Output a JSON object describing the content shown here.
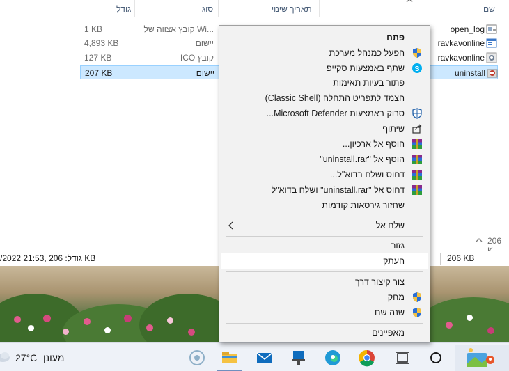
{
  "explorer": {
    "columns": {
      "name": "שם",
      "modified": "תאריך שינוי",
      "type": "סוג",
      "size": "גודל"
    },
    "files": [
      {
        "name": "open_log",
        "type": "...Wi קובץ אצווה של",
        "size": "1 KB",
        "icon": "batch-file-icon"
      },
      {
        "name": "ravkavonline",
        "type": "יישום",
        "size": "4,893 KB",
        "icon": "app-window-icon"
      },
      {
        "name": "ravkavonline",
        "type": "קובץ ICO",
        "size": "127 KB",
        "icon": "ico-file-icon"
      },
      {
        "name": "uninstall",
        "type": "יישום",
        "size": "207 KB",
        "icon": "uninstall-app-icon",
        "selected": true
      }
    ],
    "right_size": "206 K",
    "status_left": "/2022 21:53,  גודל: 206 KB",
    "status_right": "206 KB"
  },
  "context_menu": {
    "items": [
      {
        "label": "פתח",
        "bold": true
      },
      {
        "label": "הפעל כמנהל מערכת",
        "icon": "uac-shield-icon"
      },
      {
        "label": "שתף באמצעות סקייפ",
        "icon": "skype-icon"
      },
      {
        "label": "פתור בעיות תאימות"
      },
      {
        "label": "הצמד לתפריט התחלה (Classic Shell)"
      },
      {
        "label": "סרוק באמצעות Microsoft Defender...",
        "icon": "defender-icon"
      },
      {
        "label": "שיתוף",
        "icon": "share-icon"
      },
      {
        "label": "הוסף אל ארכיון...",
        "icon": "winrar-icon"
      },
      {
        "label": "הוסף אל \"uninstall.rar\"",
        "icon": "winrar-icon"
      },
      {
        "label": "דחוס ושלח בדוא\"ל...",
        "icon": "winrar-icon"
      },
      {
        "label": "דחוס אל \"uninstall.rar\" ושלח בדוא\"ל",
        "icon": "winrar-icon"
      },
      {
        "label": "שחזור גירסאות קודמות"
      },
      {
        "label": "שלח אל",
        "submenu": true
      },
      {
        "label": "גזור"
      },
      {
        "label": "העתק",
        "hover": true
      },
      {
        "label": "צור קיצור דרך"
      },
      {
        "label": "מחק",
        "icon": "uac-shield-icon"
      },
      {
        "label": "שנה שם",
        "icon": "uac-shield-icon"
      },
      {
        "label": "מאפיינים"
      }
    ]
  },
  "taskbar": {
    "weather_temp": "27°C",
    "weather_condition": "מעונן",
    "icons": [
      "weather-cloud-icon",
      "widgets-icon",
      "file-explorer-icon",
      "mail-icon",
      "store-icon",
      "edge-icon",
      "chrome-icon",
      "task-view-icon",
      "search-circle-icon",
      "start-app-icon"
    ]
  },
  "colors": {
    "selection": "#cce8ff",
    "menu_bg": "#f2f2f2",
    "header_text": "#4c607a",
    "taskbar_bg": "#eef2f8"
  }
}
